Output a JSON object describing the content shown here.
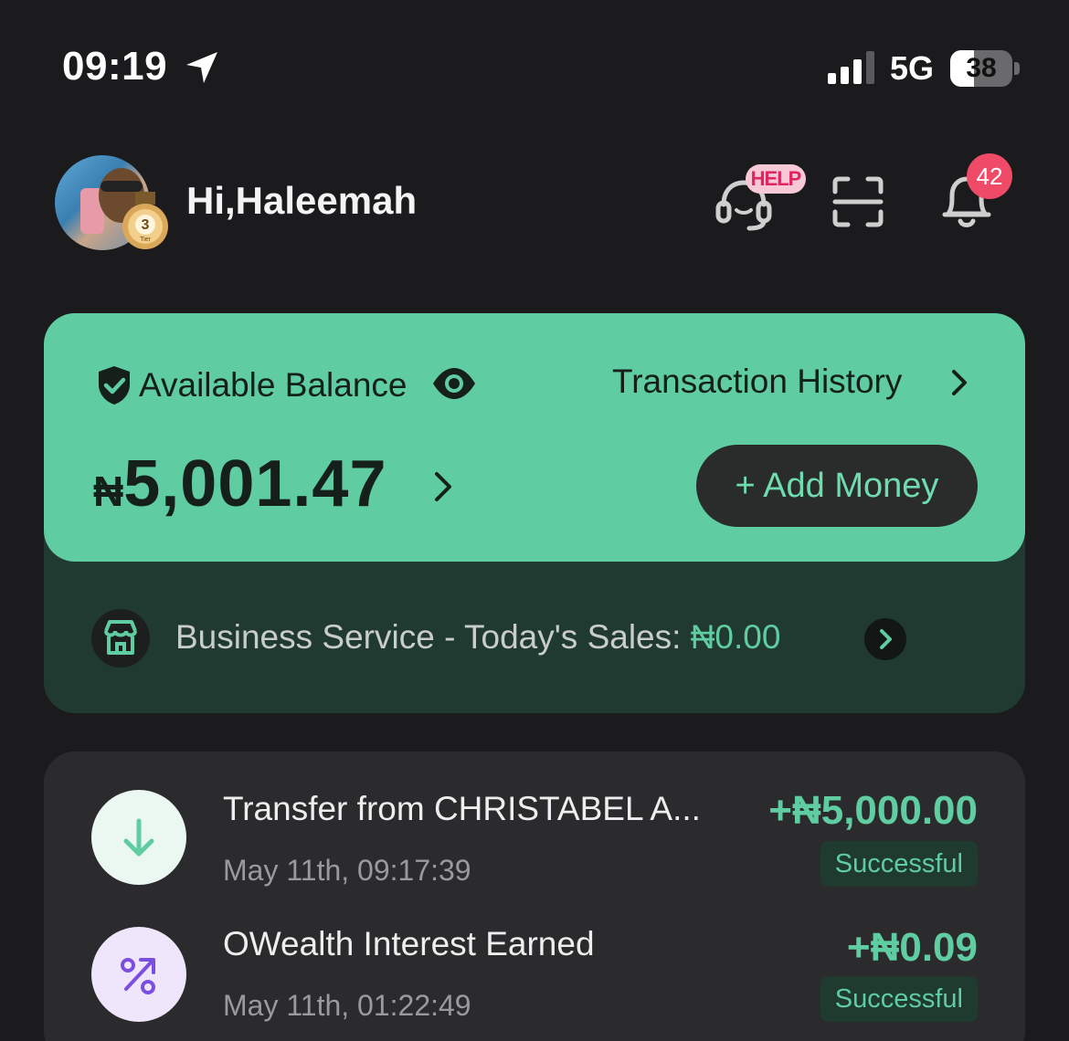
{
  "status_bar": {
    "time": "09:19",
    "network": "5G",
    "battery": "38",
    "battery_level_percent": 38,
    "icons": [
      "location-arrow-icon",
      "signal-icon",
      "battery-icon"
    ]
  },
  "header": {
    "greeting": "Hi,Haleemah",
    "tier_number": "3",
    "tier_label": "Tier",
    "help_tag": "HELP",
    "notification_count": "42",
    "icons": [
      "avatar",
      "tier-medal-icon",
      "headset-help-icon",
      "scan-icon",
      "bell-icon"
    ]
  },
  "balance": {
    "label": "Available Balance",
    "currency_symbol": "₦",
    "amount": "5,001.47",
    "transaction_history": "Transaction History",
    "add_money": "+ Add Money",
    "icons": [
      "shield-check-icon",
      "eye-icon",
      "chevron-right-icon"
    ]
  },
  "business": {
    "text": "Business Service - Today's Sales:",
    "value": "₦0.00",
    "icons": [
      "store-icon",
      "chevron-right-icon"
    ]
  },
  "transactions": [
    {
      "title": "Transfer from CHRISTABEL A...",
      "date": "May 11th, 09:17:39",
      "amount": "+₦5,000.00",
      "status": "Successful",
      "icon": "arrow-down-icon"
    },
    {
      "title": "OWealth Interest Earned",
      "date": "May 11th, 01:22:49",
      "amount": "+₦0.09",
      "status": "Successful",
      "icon": "percent-trend-icon"
    }
  ],
  "colors": {
    "background": "#1b1b1d",
    "accent_green": "#5fcca1",
    "card_dark_green": "#203a31",
    "badge_red": "#ef4b68",
    "help_pink": "#f7c8d6",
    "purple_icon": "#7a4fe0"
  }
}
